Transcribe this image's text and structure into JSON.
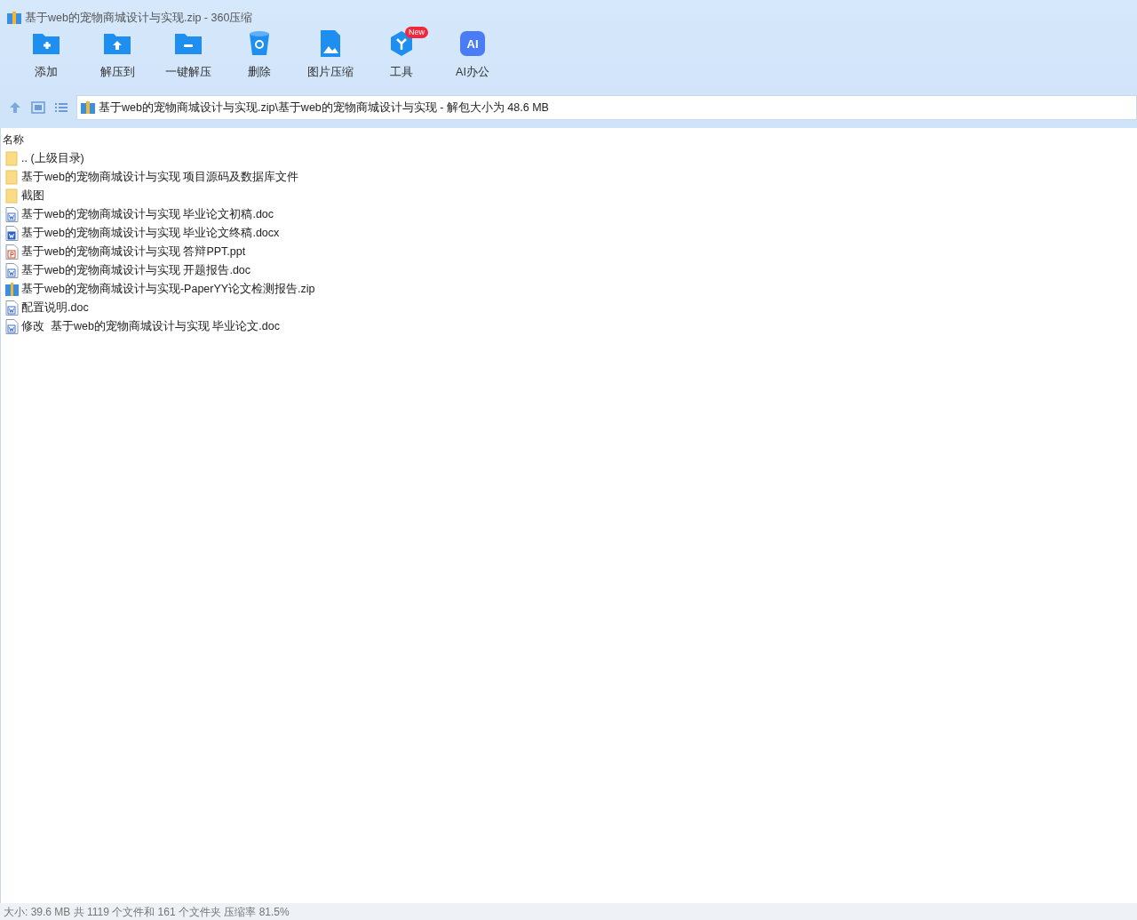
{
  "window": {
    "title": "基于web的宠物商城设计与实现.zip - 360压缩"
  },
  "toolbar": [
    {
      "kind": "add",
      "label": "添加"
    },
    {
      "kind": "extract",
      "label": "解压到"
    },
    {
      "kind": "oneclick",
      "label": "一键解压"
    },
    {
      "kind": "delete",
      "label": "删除"
    },
    {
      "kind": "image",
      "label": "图片压缩"
    },
    {
      "kind": "tools",
      "label": "工具",
      "badge": "New"
    },
    {
      "kind": "ai",
      "label": "AI办公",
      "glyph": "AI"
    }
  ],
  "address": {
    "path": "基于web的宠物商城设计与实现.zip\\基于web的宠物商城设计与实现 - 解包大小为 48.6 MB"
  },
  "list": {
    "columns": [
      "名称"
    ],
    "rows": [
      {
        "kind": "folder",
        "name": ".. (上级目录)"
      },
      {
        "kind": "folder",
        "name": "基于web的宠物商城设计与实现 项目源码及数据库文件"
      },
      {
        "kind": "folder",
        "name": "截图"
      },
      {
        "kind": "doc",
        "name": "基于web的宠物商城设计与实现 毕业论文初稿.doc"
      },
      {
        "kind": "docx",
        "name": "基于web的宠物商城设计与实现 毕业论文终稿.docx"
      },
      {
        "kind": "ppt",
        "name": "基于web的宠物商城设计与实现 答辩PPT.ppt"
      },
      {
        "kind": "doc",
        "name": "基于web的宠物商城设计与实现 开题报告.doc"
      },
      {
        "kind": "zip",
        "name": "基于web的宠物商城设计与实现-PaperYY论文检测报告.zip"
      },
      {
        "kind": "doc",
        "name": "配置说明.doc"
      },
      {
        "kind": "doc",
        "name": "修改  基于web的宠物商城设计与实现 毕业论文.doc"
      }
    ]
  },
  "status_bar": "大小: 39.6 MB 共 1119 个文件和 161 个文件夹 压缩率 81.5%"
}
